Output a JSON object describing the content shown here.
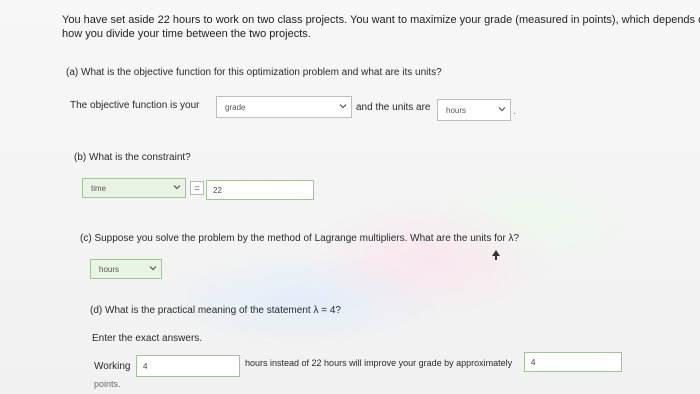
{
  "intro": {
    "line1": "You have set aside 22 hours to work on two class projects. You want to maximize your grade (measured in points), which depends on",
    "line2": "how you divide your time between the two projects."
  },
  "part_a": {
    "question": "(a) What is the objective function for this optimization problem and what are its units?",
    "prefix": "The objective function is your",
    "objective_value": "grade",
    "middle": "and the units are",
    "units_value": "hours",
    "suffix": "."
  },
  "part_b": {
    "question": "(b) What is the constraint?",
    "variable_value": "time",
    "equals": "=",
    "amount_value": "22"
  },
  "part_c": {
    "question": "(c) Suppose you solve the problem by the method of Lagrange multipliers. What are the units for λ?",
    "units_value": "hours"
  },
  "part_d": {
    "question": "(d) What is the practical meaning of the statement λ = 4?",
    "instruction": "Enter the exact answers.",
    "working_label": "Working",
    "working_value": "4",
    "middle": "hours instead of 22 hours will improve your grade by approximately",
    "improve_value": "4",
    "tail": "points."
  },
  "icons": {
    "dropdown": "chevron-down-icon",
    "cursor": "mouse-pointer-icon"
  },
  "colors": {
    "filled_field_bg": "#e9f4e4",
    "filled_field_border": "#9fc596"
  }
}
